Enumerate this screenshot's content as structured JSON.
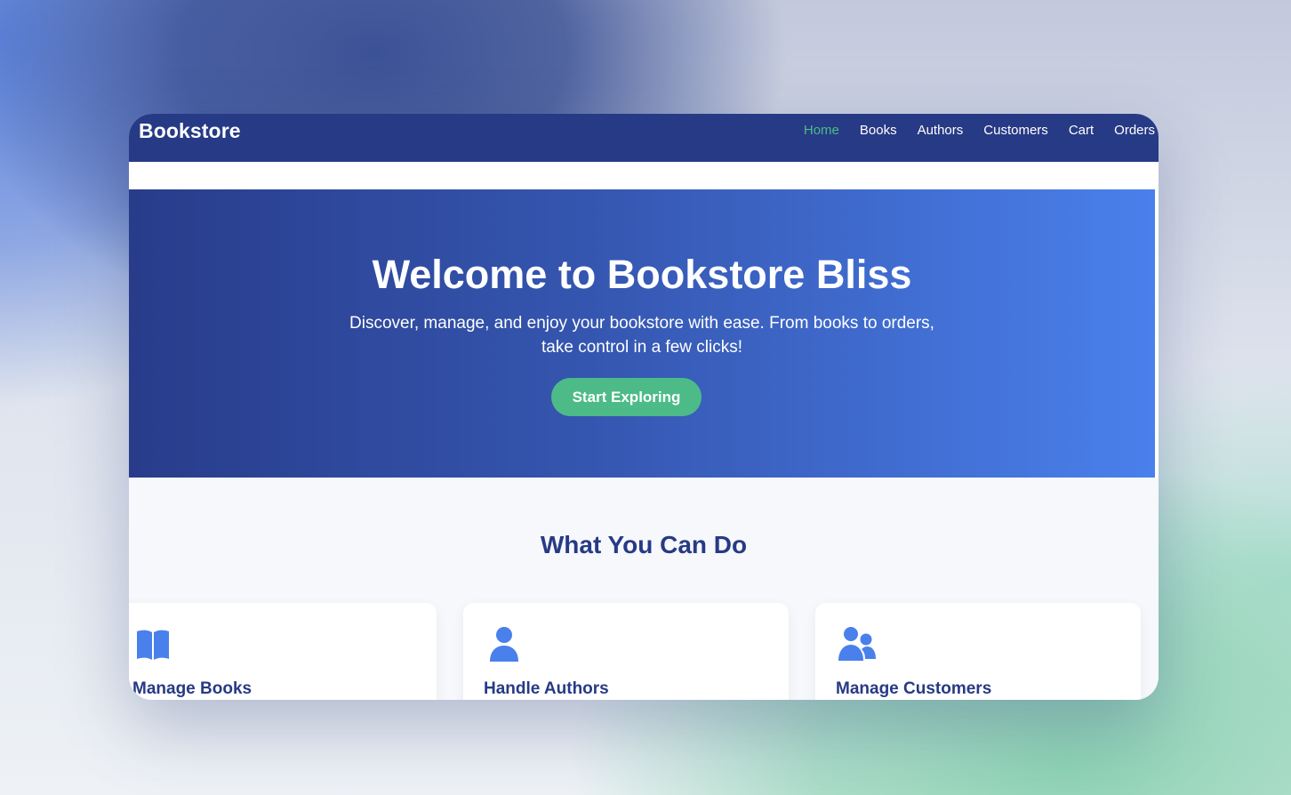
{
  "navbar": {
    "brand": "Bookstore",
    "links": [
      {
        "label": "Home",
        "active": true
      },
      {
        "label": "Books"
      },
      {
        "label": "Authors"
      },
      {
        "label": "Customers"
      },
      {
        "label": "Cart"
      },
      {
        "label": "Orders"
      }
    ]
  },
  "hero": {
    "title": "Welcome to Bookstore Bliss",
    "subtitle": "Discover, manage, and enjoy your bookstore with ease. From books to orders, take control in a few clicks!",
    "cta_label": "Start Exploring"
  },
  "features": {
    "title": "What You Can Do",
    "cards": [
      {
        "icon": "open-book-icon",
        "title": "Manage Books"
      },
      {
        "icon": "user-icon",
        "title": "Handle Authors"
      },
      {
        "icon": "users-icon",
        "title": "Manage Customers"
      }
    ]
  },
  "colors": {
    "navbar": "#273a85",
    "accent_green": "#4cbb88",
    "hero_start": "#283c8a",
    "hero_end": "#4a80ec",
    "icon_blue": "#4a80ec"
  }
}
